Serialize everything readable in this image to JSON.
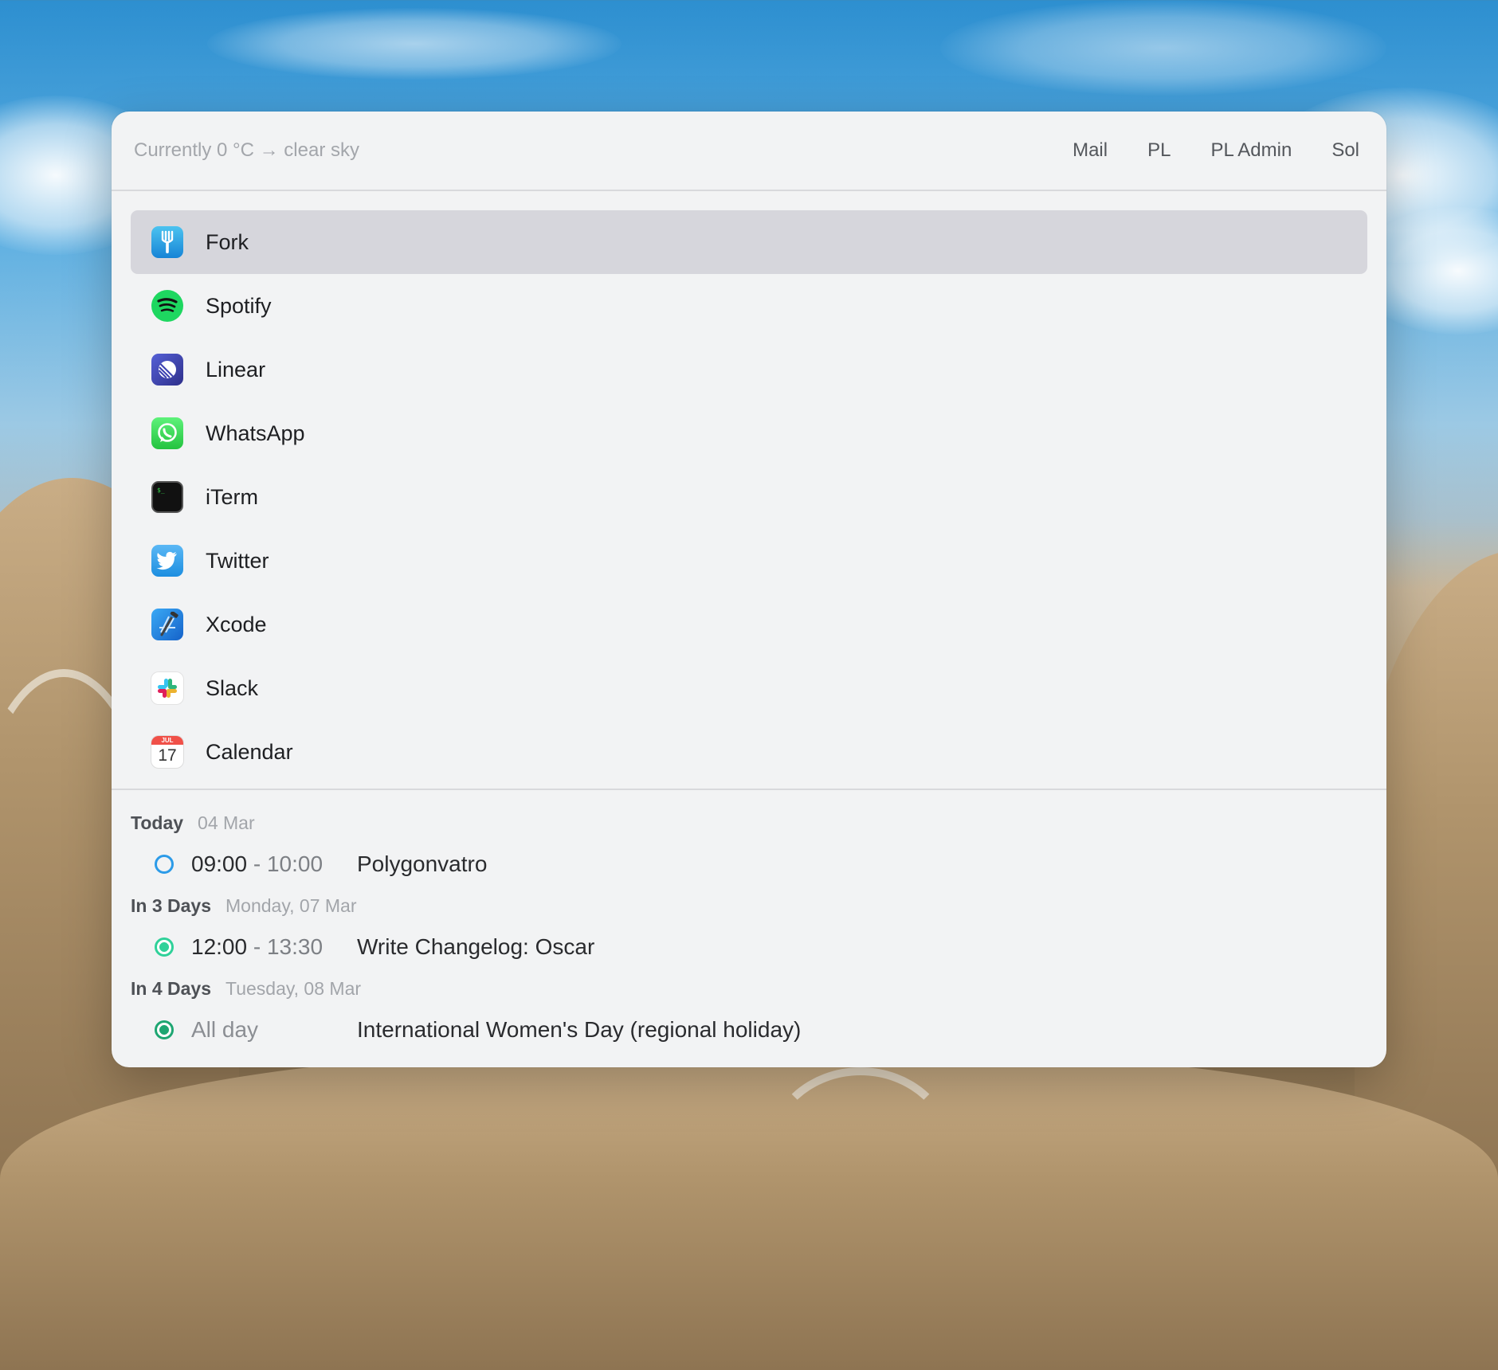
{
  "header": {
    "weather": "Currently 0 °C → clear sky",
    "links": [
      "Mail",
      "PL",
      "PL Admin",
      "Sol"
    ]
  },
  "apps": [
    {
      "label": "Fork",
      "icon": "fork-icon",
      "selected": true
    },
    {
      "label": "Spotify",
      "icon": "spotify-icon"
    },
    {
      "label": "Linear",
      "icon": "linear-icon"
    },
    {
      "label": "WhatsApp",
      "icon": "whatsapp-icon"
    },
    {
      "label": "iTerm",
      "icon": "iterm-icon"
    },
    {
      "label": "Twitter",
      "icon": "twitter-icon"
    },
    {
      "label": "Xcode",
      "icon": "xcode-icon"
    },
    {
      "label": "Slack",
      "icon": "slack-icon"
    },
    {
      "label": "Calendar",
      "icon": "calendar-icon",
      "calendar_month": "JUL",
      "calendar_day": "17"
    }
  ],
  "calendar": [
    {
      "relative": "Today",
      "date": "04 Mar",
      "events": [
        {
          "start": "09:00",
          "end": "10:00",
          "title": "Polygonvatro",
          "color": "#2c9be8",
          "status": "open"
        }
      ]
    },
    {
      "relative": "In 3 Days",
      "date": "Monday, 07 Mar",
      "events": [
        {
          "start": "12:00",
          "end": "13:30",
          "title": "Write Changelog: Oscar",
          "color": "#2fd199",
          "status": "filled"
        }
      ]
    },
    {
      "relative": "In 4 Days",
      "date": "Tuesday, 08 Mar",
      "events": [
        {
          "start": "All day",
          "end": "",
          "title": "International Women's Day (regional holiday)",
          "color": "#1ea672",
          "status": "filled"
        }
      ]
    }
  ],
  "colors": {
    "selected_row": "#d6d6dc",
    "panel_bg": "#f2f3f4"
  }
}
